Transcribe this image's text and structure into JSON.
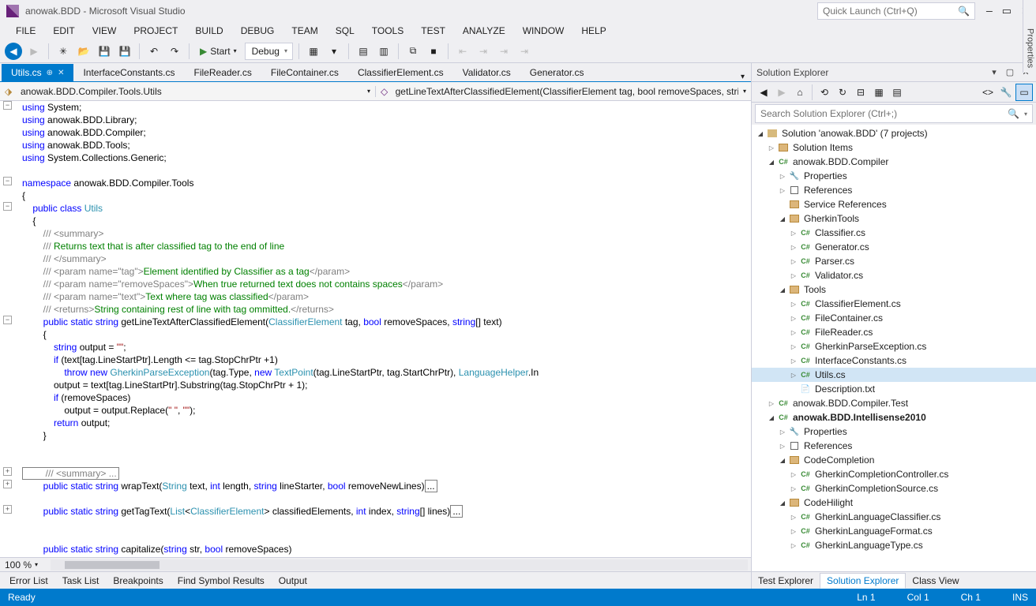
{
  "app": {
    "title": "anowak.BDD - Microsoft Visual Studio"
  },
  "quicklaunch": {
    "placeholder": "Quick Launch (Ctrl+Q)"
  },
  "menu": [
    "FILE",
    "EDIT",
    "VIEW",
    "PROJECT",
    "BUILD",
    "DEBUG",
    "TEAM",
    "SQL",
    "TOOLS",
    "TEST",
    "ANALYZE",
    "WINDOW",
    "HELP"
  ],
  "toolbar": {
    "start": "Start",
    "config": "Debug"
  },
  "tabs": [
    {
      "label": "Utils.cs",
      "active": true
    },
    {
      "label": "InterfaceConstants.cs"
    },
    {
      "label": "FileReader.cs"
    },
    {
      "label": "FileContainer.cs"
    },
    {
      "label": "ClassifierElement.cs"
    },
    {
      "label": "Validator.cs"
    },
    {
      "label": "Generator.cs"
    }
  ],
  "nav": {
    "left": "anowak.BDD.Compiler.Tools.Utils",
    "right": "getLineTextAfterClassifiedElement(ClassifierElement tag, bool removeSpaces, string[] text)"
  },
  "zoom": "100 %",
  "bottom_tabs": [
    "Error List",
    "Task List",
    "Breakpoints",
    "Find Symbol Results",
    "Output"
  ],
  "status": {
    "ready": "Ready",
    "ln": "Ln 1",
    "col": "Col 1",
    "ch": "Ch 1",
    "ins": "INS"
  },
  "solution_explorer": {
    "title": "Solution Explorer",
    "search": "Search Solution Explorer (Ctrl+;)",
    "root": "Solution 'anowak.BDD' (7 projects)",
    "items": {
      "solution_items": "Solution Items",
      "compiler": "anowak.BDD.Compiler",
      "properties": "Properties",
      "references": "References",
      "service_refs": "Service References",
      "gherkin_tools": "GherkinTools",
      "classifier": "Classifier.cs",
      "generator": "Generator.cs",
      "parser": "Parser.cs",
      "validator": "Validator.cs",
      "tools": "Tools",
      "classifier_elem": "ClassifierElement.cs",
      "file_container": "FileContainer.cs",
      "file_reader": "FileReader.cs",
      "gpe": "GherkinParseException.cs",
      "iconst": "InterfaceConstants.cs",
      "utils": "Utils.cs",
      "desc": "Description.txt",
      "compiler_test": "anowak.BDD.Compiler.Test",
      "intellisense": "anowak.BDD.Intellisense2010",
      "code_completion": "CodeCompletion",
      "gcc": "GherkinCompletionController.cs",
      "gcs": "GherkinCompletionSource.cs",
      "code_hilight": "CodeHilight",
      "glc": "GherkinLanguageClassifier.cs",
      "glf": "GherkinLanguageFormat.cs",
      "glt": "GherkinLanguageType.cs"
    }
  },
  "pane_tabs": [
    "Test Explorer",
    "Solution Explorer",
    "Class View"
  ],
  "side_tab": "Properties",
  "code": {
    "l1": "using",
    "l1b": " System;",
    "l2": "using",
    "l2b": " anowak.BDD.Library;",
    "l3": "using",
    "l3b": " anowak.BDD.Compiler;",
    "l4": "using",
    "l4b": " anowak.BDD.Tools;",
    "l5": "using",
    "l5b": " System.Collections.Generic;",
    "ns": "namespace",
    "nsb": " anowak.BDD.Compiler.Tools",
    "cls_pre": "    public class ",
    "cls": "Utils",
    "c1": "        /// <summary>",
    "c2a": "        /// ",
    "c2b": "Returns text that is after classified tag to the end of line",
    "c3": "        /// </summary>",
    "c4a": "        /// <param name=\"tag\">",
    "c4m": "Element identified by Classifier as a tag",
    "c4b": "</param>",
    "c5a": "        /// <param name=\"removeSpaces\">",
    "c5m": "When true returned text does not contains spaces",
    "c5b": "</param>",
    "c6a": "        /// <param name=\"text\">",
    "c6m": "Text where tag was classified",
    "c6b": "</param>",
    "c7a": "        /// <returns>",
    "c7m": "String containing rest of line with tag ommitted.",
    "c7b": "</returns>",
    "m1a": "        public static ",
    "m1b": "string",
    "m1c": " getLineTextAfterClassifiedElement(",
    "m1d": "ClassifierElement",
    "m1e": " tag, ",
    "m1f": "bool",
    "m1g": " removeSpaces, ",
    "m1h": "string",
    "m1i": "[] text)",
    "b1a": "            string",
    "b1b": " output = ",
    "b1c": "\"\"",
    "b1d": ";",
    "b2a": "            if",
    "b2b": " (text[tag.LineStartPtr].Length <= tag.StopChrPtr +1)",
    "b3a": "                throw new ",
    "b3b": "GherkinParseException",
    "b3c": "(tag.Type, ",
    "b3d": "new ",
    "b3e": "TextPoint",
    "b3f": "(tag.LineStartPtr, tag.StartChrPtr), ",
    "b3g": "LanguageHelper",
    "b3h": ".In",
    "b4": "            output = text[tag.LineStartPtr].Substring(tag.StopChrPtr + 1);",
    "b5a": "            if",
    "b5b": " (removeSpaces)",
    "b6a": "                output = output.Replace(",
    "b6b": "\" \"",
    "b6c": ", ",
    "b6d": "\"\"",
    "b6e": ");",
    "b7a": "            return",
    "b7b": " output;",
    "fold1": "        /// <summary> ...",
    "m2a": "        public static ",
    "m2b": "string",
    "m2c": " wrapText(",
    "m2d": "String",
    "m2e": " text, ",
    "m2f": "int",
    "m2g": " length, ",
    "m2h": "string",
    "m2i": " lineStarter, ",
    "m2j": "bool",
    "m2k": " removeNewLines)",
    "m2l": "...",
    "m3a": "        public static ",
    "m3b": "string",
    "m3c": " getTagText(",
    "m3d": "List",
    "m3e": "<",
    "m3f": "ClassifierElement",
    "m3g": "> classifiedElements, ",
    "m3h": "int",
    "m3i": " index, ",
    "m3j": "string",
    "m3k": "[] lines)",
    "m3l": "...",
    "m4a": "        public static ",
    "m4b": "string",
    "m4c": " capitalize(",
    "m4d": "string",
    "m4e": " str, ",
    "m4f": "bool",
    "m4g": " removeSpaces)"
  }
}
